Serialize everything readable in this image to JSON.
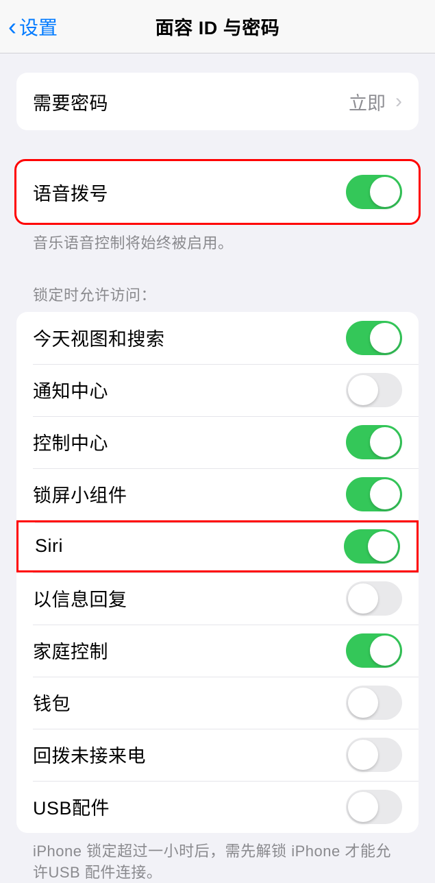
{
  "nav": {
    "back_label": "设置",
    "title": "面容 ID 与密码"
  },
  "require_passcode": {
    "label": "需要密码",
    "value": "立即"
  },
  "voice_dial": {
    "label": "语音拨号",
    "enabled": true,
    "footer": "音乐语音控制将始终被启用。"
  },
  "locked_access": {
    "header": "锁定时允许访问：",
    "items": [
      {
        "key": "today-view",
        "label": "今天视图和搜索",
        "enabled": true
      },
      {
        "key": "notification-center",
        "label": "通知中心",
        "enabled": false
      },
      {
        "key": "control-center",
        "label": "控制中心",
        "enabled": true
      },
      {
        "key": "lock-screen-widgets",
        "label": "锁屏小组件",
        "enabled": true
      },
      {
        "key": "siri",
        "label": "Siri",
        "enabled": true
      },
      {
        "key": "reply-message",
        "label": "以信息回复",
        "enabled": false
      },
      {
        "key": "home-control",
        "label": "家庭控制",
        "enabled": true
      },
      {
        "key": "wallet",
        "label": "钱包",
        "enabled": false
      },
      {
        "key": "return-missed-calls",
        "label": "回拨未接来电",
        "enabled": false
      },
      {
        "key": "usb-accessories",
        "label": "USB配件",
        "enabled": false
      }
    ],
    "footer": "iPhone 锁定超过一小时后，需先解锁 iPhone 才能允许USB 配件连接。"
  },
  "highlighted_rows": [
    "voice-dial",
    "siri"
  ]
}
